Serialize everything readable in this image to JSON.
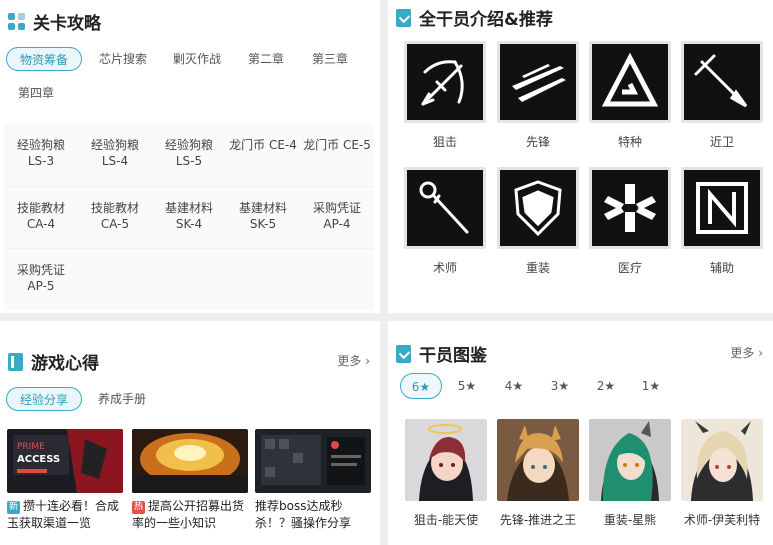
{
  "levels": {
    "title": "关卡攻略",
    "tabs": [
      "物资筹备",
      "芯片搜索",
      "剿灭作战",
      "第二章",
      "第三章",
      "第四章"
    ],
    "rows": [
      [
        {
          "name": "经验狗粮",
          "code": "LS-3"
        },
        {
          "name": "经验狗粮",
          "code": "LS-4"
        },
        {
          "name": "经验狗粮",
          "code": "LS-5"
        },
        {
          "name": "龙门币 CE-4",
          "code": ""
        },
        {
          "name": "龙门币 CE-5",
          "code": ""
        }
      ],
      [
        {
          "name": "技能教材",
          "code": "CA-4"
        },
        {
          "name": "技能教材",
          "code": "CA-5"
        },
        {
          "name": "基建材料",
          "code": "SK-4"
        },
        {
          "name": "基建材料",
          "code": "SK-5"
        },
        {
          "name": "采购凭证",
          "code": "AP-4"
        }
      ],
      [
        {
          "name": "采购凭证",
          "code": "AP-5"
        }
      ]
    ]
  },
  "operators": {
    "title": "全干员介绍&推荐",
    "classes": [
      {
        "label": "狙击",
        "icon": "crossbow-icon"
      },
      {
        "label": "先锋",
        "icon": "slash-icon"
      },
      {
        "label": "特种",
        "icon": "triangle-icon"
      },
      {
        "label": "近卫",
        "icon": "sword-icon"
      },
      {
        "label": "术师",
        "icon": "staff-icon"
      },
      {
        "label": "重装",
        "icon": "shield-icon"
      },
      {
        "label": "医疗",
        "icon": "medical-icon"
      },
      {
        "label": "辅助",
        "icon": "support-icon"
      }
    ]
  },
  "tips": {
    "title": "游戏心得",
    "more": "更多",
    "tabs": [
      "经验分享",
      "养成手册"
    ],
    "articles": [
      {
        "tag": "新",
        "tag_color": "#3aa9c4",
        "title": "攒十连必看！合成玉获取渠道一览"
      },
      {
        "tag": "热",
        "tag_color": "#e8504a",
        "title": "提高公开招募出货率的一些小知识"
      },
      {
        "tag": "",
        "tag_color": "",
        "title": "推荐boss达成秒杀！？骚操作分享"
      }
    ],
    "thumb_text": {
      "prime": "PRIME",
      "access": "ACCESS"
    }
  },
  "codex": {
    "title": "干员图鉴",
    "more": "更多",
    "stars": [
      "6★",
      "5★",
      "4★",
      "3★",
      "2★",
      "1★"
    ],
    "cards": [
      {
        "name": "狙击-能天使",
        "bg": "#d9d9db",
        "hair": "#8b2f35"
      },
      {
        "name": "先锋-推进之王",
        "bg": "#7a5a40",
        "hair": "#d8a050"
      },
      {
        "name": "重装-星熊",
        "bg": "#c9c9c9",
        "hair": "#1f8f6f"
      },
      {
        "name": "术师-伊芙利特",
        "bg": "#efe6da",
        "hair": "#e5d5b0"
      }
    ]
  },
  "colors": {
    "accent": "#3aa9c4"
  }
}
